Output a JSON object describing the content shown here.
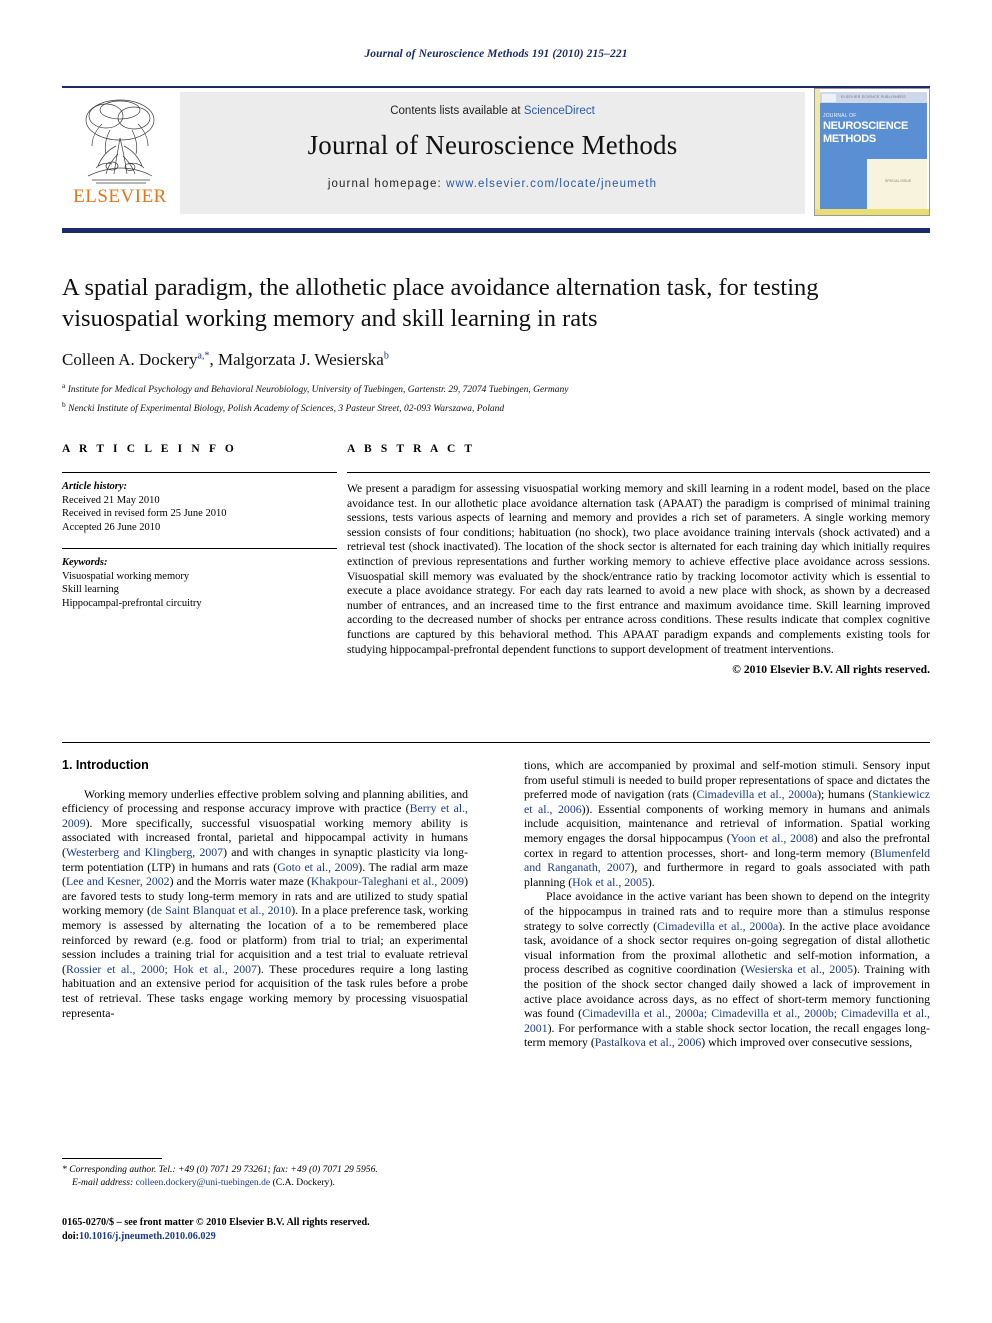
{
  "running_head": "Journal of Neuroscience Methods 191 (2010) 215–221",
  "masthead": {
    "contents_prefix": "Contents lists available at ",
    "sciencedirect": "ScienceDirect",
    "journal_title": "Journal of Neuroscience Methods",
    "homepage_label": "journal homepage: ",
    "homepage_url": "www.elsevier.com/locate/jneumeth",
    "publisher_wordmark": "ELSEVIER",
    "cover": {
      "line1": "JOURNAL OF",
      "line2": "NEUROSCIENCE",
      "line3": "METHODS",
      "header_strip": "ELSEVIER SCIENCE PUBLISHERS",
      "panel_caption": "SPECIAL ISSUE"
    }
  },
  "article": {
    "title": "A spatial paradigm, the allothetic place avoidance alternation task, for testing visuospatial working memory and skill learning in rats",
    "authors_html": "Colleen A. Dockery<sup>a,*</sup>, Malgorzata J. Wesierska<sup>b</sup>",
    "affiliation_a": "Institute for Medical Psychology and Behavioral Neurobiology, University of Tuebingen, Gartenstr. 29, 72074 Tuebingen, Germany",
    "affiliation_b": "Nencki Institute of Experimental Biology, Polish Academy of Sciences, 3 Pasteur Street, 02-093 Warszawa, Poland",
    "affiliation_a_marker": "a",
    "affiliation_b_marker": "b"
  },
  "article_info": {
    "heading": "A R T I C L E    I N F O",
    "history_label": "Article history:",
    "history": [
      "Received 21 May 2010",
      "Received in revised form 25 June 2010",
      "Accepted 26 June 2010"
    ],
    "keywords_label": "Keywords:",
    "keywords": [
      "Visuospatial working memory",
      "Skill learning",
      "Hippocampal-prefrontal circuitry"
    ]
  },
  "abstract": {
    "heading": "A B S T R A C T",
    "text": "We present a paradigm for assessing visuospatial working memory and skill learning in a rodent model, based on the place avoidance test. In our allothetic place avoidance alternation task (APAAT) the paradigm is comprised of minimal training sessions, tests various aspects of learning and memory and provides a rich set of parameters. A single working memory session consists of four conditions; habituation (no shock), two place avoidance training intervals (shock activated) and a retrieval test (shock inactivated). The location of the shock sector is alternated for each training day which initially requires extinction of previous representations and further working memory to achieve effective place avoidance across sessions. Visuospatial skill memory was evaluated by the shock/entrance ratio by tracking locomotor activity which is essential to execute a place avoidance strategy. For each day rats learned to avoid a new place with shock, as shown by a decreased number of entrances, and an increased time to the first entrance and maximum avoidance time. Skill learning improved according to the decreased number of shocks per entrance across conditions. These results indicate that complex cognitive functions are captured by this behavioral method. This APAAT paradigm expands and complements existing tools for studying hippocampal-prefrontal dependent functions to support development of treatment interventions.",
    "copyright": "© 2010 Elsevier B.V. All rights reserved."
  },
  "introduction": {
    "section_title": "1.  Introduction",
    "left_paragraph_1_html": "Working memory underlies effective problem solving and planning abilities, and efficiency of processing and response accuracy improve with practice (<span class=\"cite\">Berry et al., 2009</span>). More specifically, successful visuospatial working memory ability is associated with increased frontal, parietal and hippocampal activity in humans (<span class=\"cite\">Westerberg and Klingberg, 2007</span>) and with changes in synaptic plasticity via long-term potentiation (LTP) in humans and rats (<span class=\"cite\">Goto et al., 2009</span>). The radial arm maze (<span class=\"cite\">Lee and Kesner, 2002</span>) and the Morris water maze (<span class=\"cite\">Khakpour-Taleghani et al., 2009</span>) are favored tests to study long-term memory in rats and are utilized to study spatial working memory (<span class=\"cite\">de Saint Blanquat et al., 2010</span>). In a place preference task, working memory is assessed by alternating the location of a to be remembered place reinforced by reward (e.g. food or platform) from trial to trial; an experimental session includes a training trial for acquisition and a test trial to evaluate retrieval (<span class=\"cite\">Rossier et al., 2000; Hok et al., 2007</span>). These procedures require a long lasting habituation and an extensive period for acquisition of the task rules before a probe test of retrieval. These tasks engage working memory by processing visuospatial representa-",
    "right_paragraph_1_html": "tions, which are accompanied by proximal and self-motion stimuli. Sensory input from useful stimuli is needed to build proper representations of space and dictates the preferred mode of navigation (rats (<span class=\"cite\">Cimadevilla et al., 2000a</span>); humans (<span class=\"cite\">Stankiewicz et al., 2006</span>)). Essential components of working memory in humans and animals include acquisition, maintenance and retrieval of information. Spatial working memory engages the dorsal hippocampus (<span class=\"cite\">Yoon et al., 2008</span>) and also the prefrontal cortex in regard to attention processes, short- and long-term memory (<span class=\"cite\">Blumenfeld and Ranganath, 2007</span>), and furthermore in regard to goals associated with path planning (<span class=\"cite\">Hok et al., 2005</span>).",
    "right_paragraph_2_html": "Place avoidance in the active variant has been shown to depend on the integrity of the hippocampus in trained rats and to require more than a stimulus response strategy to solve correctly (<span class=\"cite\">Cimadevilla et al., 2000a</span>). In the active place avoidance task, avoidance of a shock sector requires on-going segregation of distal allothetic visual information from the proximal allothetic and self-motion information, a process described as cognitive coordination (<span class=\"cite\">Wesierska et al., 2005</span>). Training with the position of the shock sector changed daily showed a lack of improvement in active place avoidance across days, as no effect of short-term memory functioning was found (<span class=\"cite\">Cimadevilla et al., 2000a; Cimadevilla et al., 2000b; Cimadevilla et al., 2001</span>). For performance with a stable shock sector location, the recall engages long-term memory (<span class=\"cite\">Pastalkova et al., 2006</span>) which improved over consecutive sessions,"
  },
  "footnote": {
    "corresponding_html": "* <i>Corresponding author. Tel.: +49 (0) 7071 29 73261; fax: +49 (0) 7071 29 5956.</i>",
    "email_label": "E-mail address:",
    "email": "colleen.dockery@uni-tuebingen.de",
    "email_suffix": "(C.A. Dockery)."
  },
  "imprint": {
    "issn_line": "0165-0270/$ – see front matter © 2010 Elsevier B.V. All rights reserved.",
    "doi_label": "doi:",
    "doi_value": "10.1016/j.jneumeth.2010.06.029"
  },
  "colors": {
    "running_head": "#1a2a6c",
    "link_blue": "#2a58a8",
    "citation_blue": "#1a3a8c",
    "elsevier_orange": "#e8731a",
    "masthead_grey": "#ececec"
  }
}
